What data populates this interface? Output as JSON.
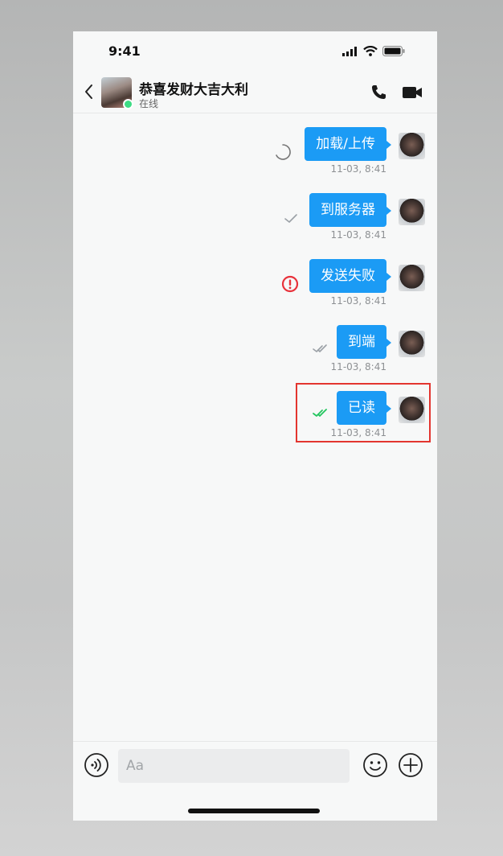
{
  "status_bar": {
    "time": "9:41",
    "icons": [
      "signal-icon",
      "wifi-icon",
      "battery-icon"
    ]
  },
  "header": {
    "contact_name": "恭喜发财大吉大利",
    "contact_status": "在线",
    "icons": [
      "back-icon",
      "phone-icon",
      "video-camera-icon"
    ]
  },
  "messages": [
    {
      "text": "加载/上传",
      "time": "11-03, 8:41",
      "status": "loading"
    },
    {
      "text": "到服务器",
      "time": "11-03, 8:41",
      "status": "sent"
    },
    {
      "text": "发送失败",
      "time": "11-03, 8:41",
      "status": "failed"
    },
    {
      "text": "到端",
      "time": "11-03, 8:41",
      "status": "delivered"
    },
    {
      "text": "已读",
      "time": "11-03, 8:41",
      "status": "read"
    }
  ],
  "colors": {
    "bubble": "#1b9bf5",
    "failed": "#e8323b",
    "read": "#22c55e",
    "highlight": "#e3352f",
    "online": "#3ddc84"
  },
  "input_bar": {
    "placeholder": "Aa",
    "icons": [
      "voice-icon",
      "emoji-icon",
      "plus-icon"
    ]
  }
}
